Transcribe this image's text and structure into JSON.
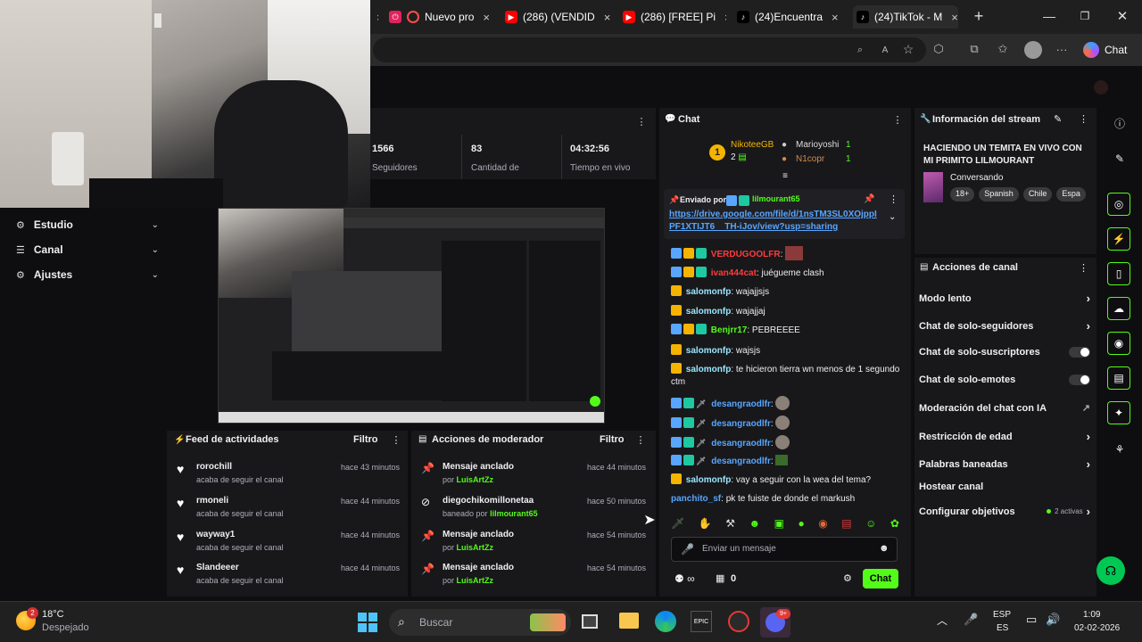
{
  "browser": {
    "tabs": [
      {
        "title": "Nuevo pro"
      },
      {
        "title": "(286) (VENDID"
      },
      {
        "title": "(286) [FREE] Pi"
      },
      {
        "title": "(24)Encuentra"
      },
      {
        "title": "(24)TikTok - M"
      }
    ],
    "copilot_label": "Chat"
  },
  "stats": {
    "followers_value": "1566",
    "followers_label": "Seguidores",
    "count_value": "83",
    "count_label": "Cantidad de",
    "time_value": "04:32:56",
    "time_label": "Tiempo en vivo"
  },
  "left_nav": {
    "items": [
      {
        "label": "Estudio"
      },
      {
        "label": "Canal"
      },
      {
        "label": "Ajustes"
      }
    ]
  },
  "feed": {
    "title": "Feed de actividades",
    "filter_label": "Filtro",
    "items": [
      {
        "name": "rorochill",
        "action": "acaba de seguir el canal",
        "time": "hace 43 minutos"
      },
      {
        "name": "rmoneli",
        "action": "acaba de seguir el canal",
        "time": "hace 44 minutos"
      },
      {
        "name": "wayway1",
        "action": "acaba de seguir el canal",
        "time": "hace 44 minutos"
      },
      {
        "name": "Slandeeer",
        "action": "acaba de seguir el canal",
        "time": "hace 44 minutos"
      }
    ]
  },
  "mod": {
    "title": "Acciones de moderador",
    "filter_label": "Filtro",
    "items": [
      {
        "title": "Mensaje anclado",
        "by_prefix": "por",
        "by": "LuisArtZz",
        "time": "hace 44 minutos"
      },
      {
        "title": "diegochikomillonetaa",
        "by_prefix": "baneado por",
        "by": "lilmourant65",
        "time": "hace 50 minutos"
      },
      {
        "title": "Mensaje anclado",
        "by_prefix": "por",
        "by": "LuisArtZz",
        "time": "hace 54 minutos"
      },
      {
        "title": "Mensaje anclado",
        "by_prefix": "por",
        "by": "LuisArtZz",
        "time": "hace 54 minutos"
      }
    ]
  },
  "chat": {
    "title": "Chat",
    "top_gifters": [
      {
        "rank": "1",
        "name": "NikoteeGB",
        "count": "2"
      },
      {
        "name": "Marioyoshi",
        "count": "1"
      },
      {
        "name": "N1copr",
        "count": "1"
      }
    ],
    "pinned_prefix": "Enviado por",
    "pinned_user": "lilmourant65",
    "pinned_link": "https://drive.google.com/file/d/1nsTM3SL0XOjppIPF1XTIJT6__TH-iJov/view?usp=sharing",
    "messages": [
      {
        "user": "VERDUGOOLFR",
        "text": "",
        "color": "#ff3b3b"
      },
      {
        "user": "ivan444cat",
        "text": "juéguemе clash",
        "color": "#ff3b3b"
      },
      {
        "user": "salomonfp",
        "text": "wajajjsjs",
        "color": "#9ae6ff"
      },
      {
        "user": "salomonfp",
        "text": "wajajjaj",
        "color": "#9ae6ff"
      },
      {
        "user": "Benjrr17",
        "text": "PEBREEEE",
        "color": "#53fc18"
      },
      {
        "user": "salomonfp",
        "text": "wajsjs",
        "color": "#9ae6ff"
      },
      {
        "user": "salomonfp",
        "text": "te hicieron tierra wn menos de 1 segundo ctm",
        "color": "#9ae6ff"
      },
      {
        "user": "desangraodlfr",
        "text": "",
        "color": "#58a6ff"
      },
      {
        "user": "desangraodlfr",
        "text": "",
        "color": "#58a6ff"
      },
      {
        "user": "desangraodlfr",
        "text": "",
        "color": "#58a6ff"
      },
      {
        "user": "desangraodlfr",
        "text": "",
        "color": "#58a6ff"
      },
      {
        "user": "salomonfp",
        "text": "vay a seguir con la wea del tema?",
        "color": "#9ae6ff"
      },
      {
        "user": "panchito_sf",
        "text": "pk te fuiste de donde el markush",
        "color": "#58a6ff"
      }
    ],
    "input_placeholder": "Enviar un mensaje",
    "viewer_count": "0",
    "send_label": "Chat"
  },
  "stream_info": {
    "title": "Información del stream",
    "stream_title": "HACIENDO UN TEMITA EN VIVO CON MI PRIMITO LILMOURANT",
    "category": "Conversando",
    "tags": [
      "18+",
      "Spanish",
      "Chile",
      "Espa"
    ]
  },
  "channel_actions": {
    "title": "Acciones de canal",
    "items": [
      {
        "label": "Modo lento",
        "control": "chevron"
      },
      {
        "label": "Chat de solo-seguidores",
        "control": "chevron"
      },
      {
        "label": "Chat de solo-suscriptores",
        "control": "toggle"
      },
      {
        "label": "Chat de solo-emotes",
        "control": "toggle"
      },
      {
        "label": "Moderación del chat con IA",
        "control": "external"
      },
      {
        "label": "Restricción de edad",
        "control": "chevron"
      },
      {
        "label": "Palabras baneadas",
        "control": "chevron"
      },
      {
        "label": "Hostear canal",
        "control": "none"
      },
      {
        "label": "Configurar objetivos",
        "control": "chevron",
        "extra": "2 activas"
      }
    ]
  },
  "taskbar": {
    "weather_temp": "18°C",
    "weather_desc": "Despejado",
    "weather_badge": "2",
    "search_placeholder": "Buscar",
    "lang_top": "ESP",
    "lang_bottom": "ES",
    "time": "1:09",
    "date": "02-02-2026"
  },
  "colors": {
    "accent": "#53fc18",
    "panel": "#18181b",
    "bg": "#0e0e10"
  }
}
